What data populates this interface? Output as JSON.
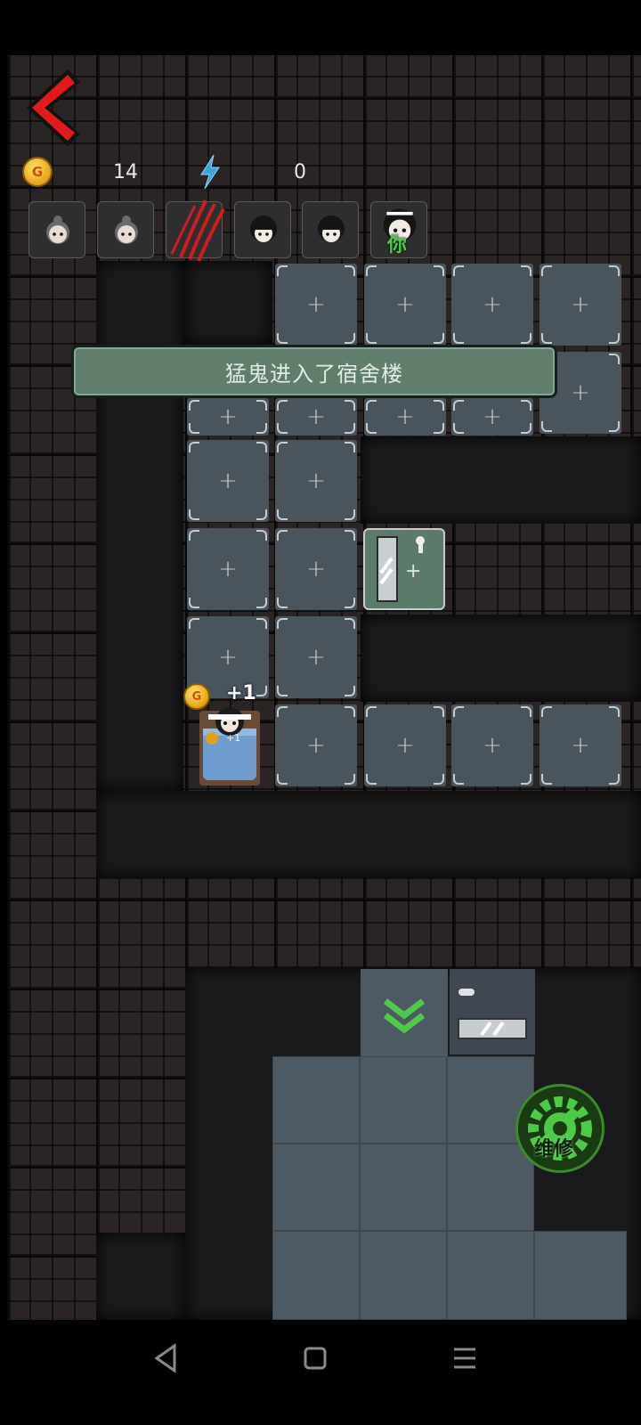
{
  "hud": {
    "back_icon": "red-chevron-left-icon",
    "coin_icon": "gold-coin-icon",
    "coin_letter": "G",
    "coins": "14",
    "energy_icon": "lightning-icon",
    "energy": "0"
  },
  "roster": [
    {
      "icon": "girl-bun-avatar-icon"
    },
    {
      "icon": "girl-bun-avatar-icon"
    },
    {
      "icon": "ghost-claw-marks-icon"
    },
    {
      "icon": "girl-dark-hair-avatar-icon"
    },
    {
      "icon": "girl-dark-hair-avatar-icon"
    },
    {
      "icon": "player-avatar-icon",
      "label": "你"
    }
  ],
  "notice": "猛鬼进入了宿舍楼",
  "board": {
    "bed_popup": "+1",
    "bed_sub_popup": "+1",
    "coin_letter": "G",
    "cell_symbol": "+",
    "accent_green": "#4fc94a",
    "notice_color": "#617e6c"
  },
  "repair": {
    "label": "维修",
    "icon": "wrench-gear-icon"
  },
  "nav": {
    "back": "nav-back-icon",
    "home": "nav-home-icon",
    "menu": "nav-menu-icon"
  }
}
